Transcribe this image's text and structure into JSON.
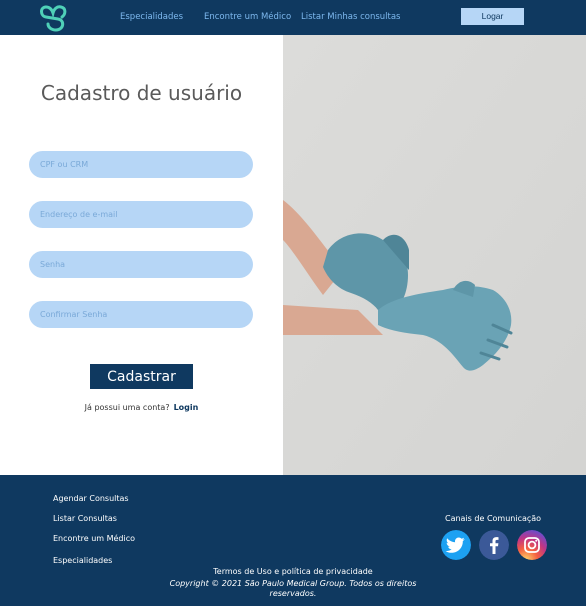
{
  "nav": {
    "links": [
      "Especialidades",
      "Encontre um Médico",
      "Listar Minhas consultas"
    ],
    "login_label": "Logar"
  },
  "form": {
    "title": "Cadastro de usuário",
    "fields": [
      "CPF ou CRM",
      "Endereço de e-mail",
      "Senha",
      "Confirmar Senha"
    ],
    "submit_label": "Cadastrar",
    "account_prompt": "Já possui uma conta?",
    "login_link": "Login"
  },
  "footer": {
    "links": [
      "Agendar Consultas",
      "Listar Consultas",
      "Encontre um Médico",
      "Especialidades"
    ],
    "channels_title": "Canais de Comunicação",
    "social_icons": [
      "twitter-icon",
      "facebook-icon",
      "instagram-icon"
    ],
    "terms": "Termos de Uso e política de privacidade",
    "copyright": "Copyright © 2021 São Paulo Medical Group. Todos os direitos reservados."
  },
  "colors": {
    "navy": "#0f3960",
    "light_blue": "#b6d6f6",
    "logo_green": "#4fd1b8",
    "glove_blue": "#5e96a8"
  }
}
